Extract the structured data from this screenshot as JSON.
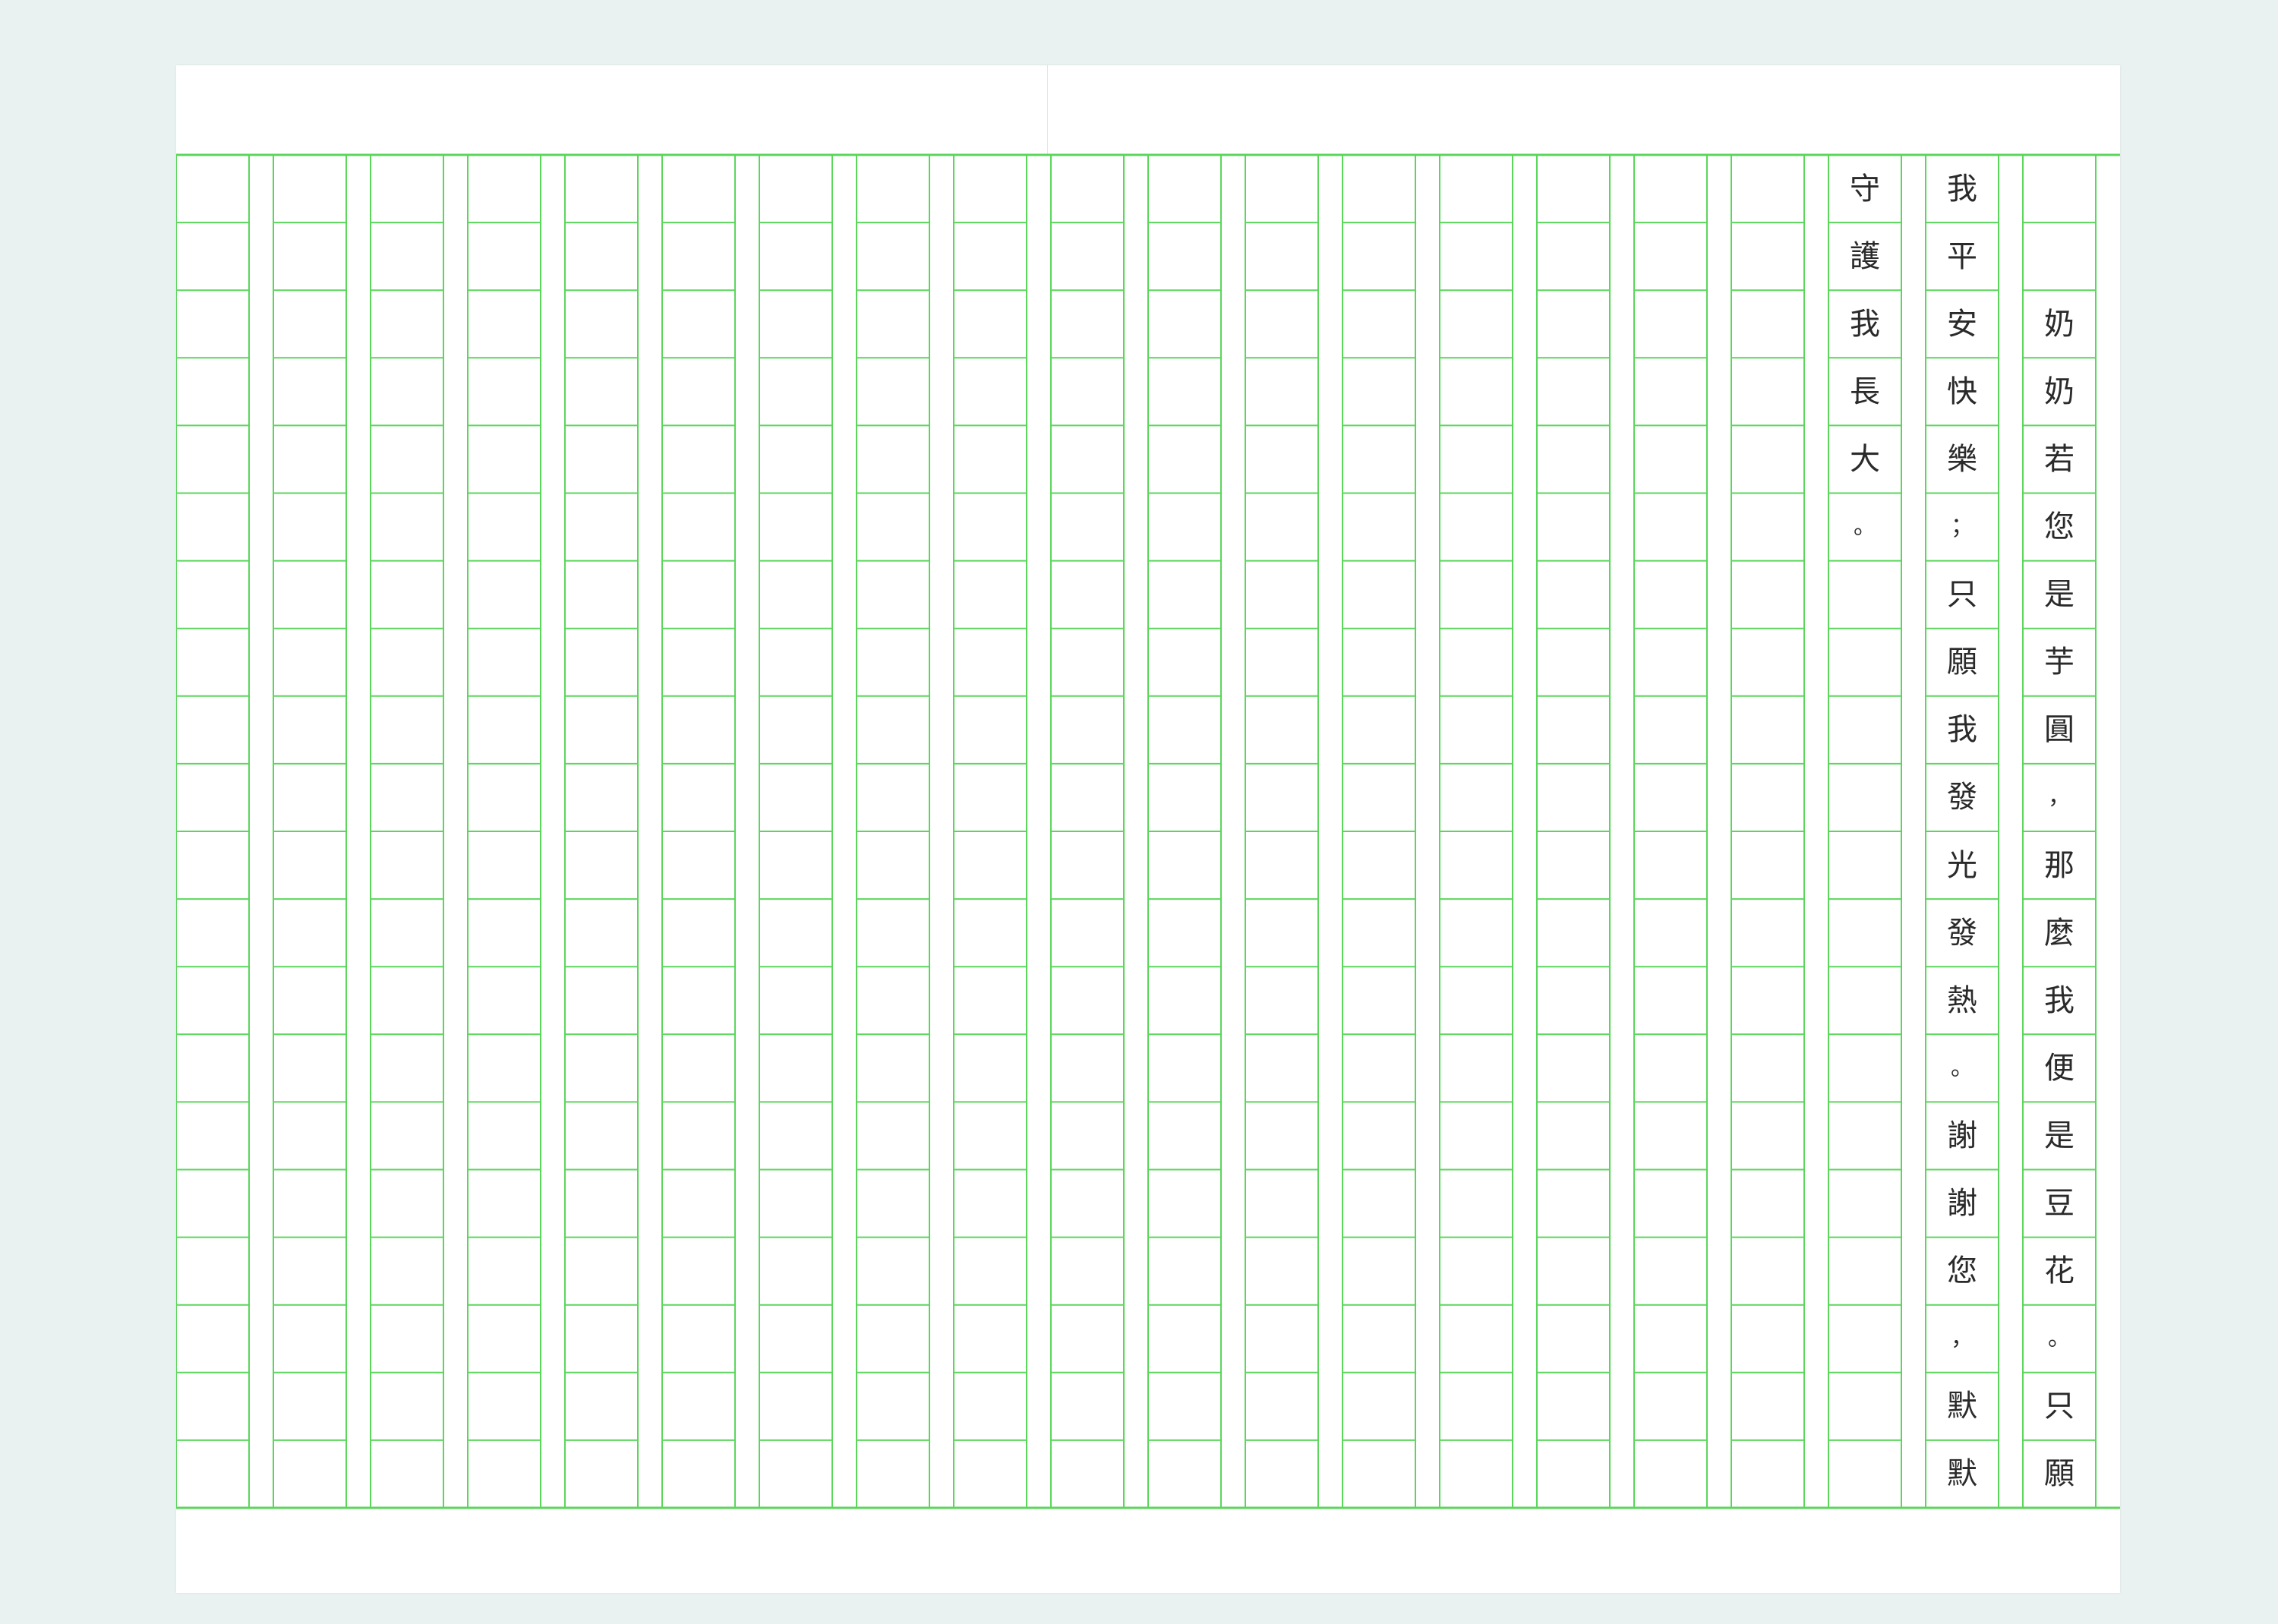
{
  "document": {
    "type": "manuscript-grid-paper",
    "grid_color": "#5bd65b",
    "ink_color": "#2a2a2a",
    "columns_total": 20,
    "rows_total": 20,
    "text_columns": [
      {
        "column_from_right": 1,
        "text": "　　奶奶若您是芋圓，那麼我便是豆花。只願"
      },
      {
        "column_from_right": 2,
        "text": "我平安快樂；只願我發光發熱。謝謝您，默默"
      },
      {
        "column_from_right": 3,
        "text": "守護我長大。"
      }
    ]
  }
}
